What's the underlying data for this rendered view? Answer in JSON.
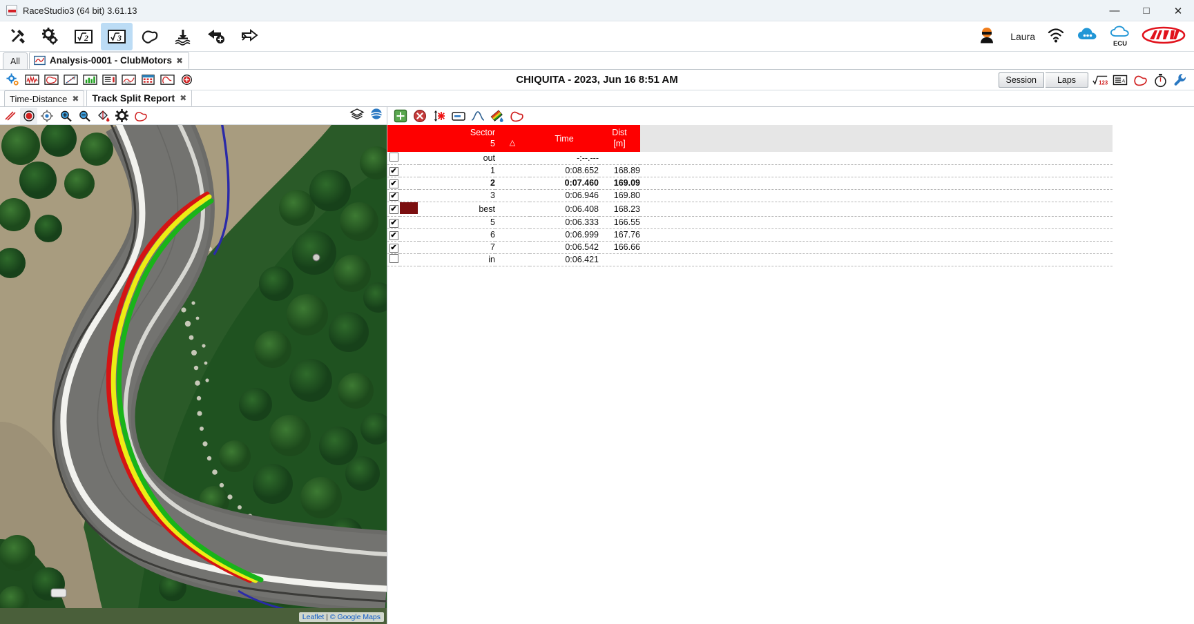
{
  "window": {
    "title": "RaceStudio3 (64 bit) 3.61.13",
    "minimize": "—",
    "maximize": "☐",
    "close": "✕"
  },
  "main_toolbar": {
    "icons": [
      {
        "name": "tools-icon",
        "label": "Tools",
        "active": false
      },
      {
        "name": "configuration-gear-icon",
        "label": "Configurations",
        "active": false
      },
      {
        "name": "rs2-analysis-icon",
        "label": "√2",
        "active": false
      },
      {
        "name": "rs3-analysis-icon",
        "label": "√3",
        "active": true
      },
      {
        "name": "tracks-icon",
        "label": "Tracks",
        "active": false
      },
      {
        "name": "device-download-icon",
        "label": "Download",
        "active": false
      },
      {
        "name": "import-arrow-icon",
        "label": "Import",
        "active": false
      },
      {
        "name": "export-arrow-icon",
        "label": "Export",
        "active": false
      }
    ],
    "user": "Laura",
    "right_icons": [
      {
        "name": "wifi-icon",
        "label": "WiFi"
      },
      {
        "name": "cloud-messages-icon",
        "label": "Messages"
      },
      {
        "name": "cloud-ecu-icon",
        "label": "ECU"
      },
      {
        "name": "aim-logo",
        "label": "AiM"
      }
    ]
  },
  "project_tabs": {
    "all_label": "All",
    "active_tab": "Analysis-0001 - ClubMotors",
    "close_glyph": "✖"
  },
  "session_toolbar": {
    "icons": [
      {
        "name": "settings-small-icon"
      },
      {
        "name": "time-distance-chart-icon"
      },
      {
        "name": "track-map-icon"
      },
      {
        "name": "xy-plot-icon"
      },
      {
        "name": "histogram-icon"
      },
      {
        "name": "report-icon"
      },
      {
        "name": "scatter-icon"
      },
      {
        "name": "calendar-icon"
      },
      {
        "name": "track-report-icon"
      },
      {
        "name": "add-red-icon"
      }
    ],
    "session_title": "CHIQUITA  - 2023, Jun 16 8:51 AM",
    "session_button": "Session",
    "laps_button": "Laps",
    "right_icons": [
      {
        "name": "math-channels-icon",
        "label": "√123"
      },
      {
        "name": "channels-list-icon"
      },
      {
        "name": "track-shape-icon"
      },
      {
        "name": "lap-timer-icon"
      },
      {
        "name": "wrench-settings-icon"
      }
    ]
  },
  "view_tabs": [
    {
      "label": "Time-Distance",
      "active": false,
      "close": "✖"
    },
    {
      "label": "Track Split Report",
      "active": true,
      "close": "✖"
    }
  ],
  "map_toolbar": {
    "left_icons": [
      {
        "name": "measure-lines-icon",
        "selected": false
      },
      {
        "name": "record-point-icon",
        "selected": true
      },
      {
        "name": "center-crosshair-icon",
        "selected": false
      },
      {
        "name": "zoom-in-icon",
        "selected": false
      },
      {
        "name": "zoom-out-icon",
        "selected": false
      },
      {
        "name": "paint-bucket-icon",
        "selected": false
      },
      {
        "name": "map-settings-gear-icon",
        "selected": false
      },
      {
        "name": "track-outline-icon",
        "selected": false
      }
    ],
    "right_icons": [
      {
        "name": "map-layers-icon"
      },
      {
        "name": "map-style-icon"
      }
    ]
  },
  "map": {
    "attribution_leaflet": "Leaflet",
    "attribution_separator": " | ",
    "attribution_provider": "© Google Maps",
    "racing_lines": [
      {
        "name": "lap-line-green",
        "color": "#19b419"
      },
      {
        "name": "lap-line-yellow",
        "color": "#eded14"
      },
      {
        "name": "lap-line-red",
        "color": "#d41414"
      },
      {
        "name": "lap-line-blue",
        "color": "#2222aa"
      }
    ]
  },
  "table_toolbar": {
    "icons": [
      {
        "name": "add-split-icon",
        "label": "+"
      },
      {
        "name": "remove-split-icon",
        "label": "✕"
      },
      {
        "name": "insert-split-icon"
      },
      {
        "name": "rename-split-icon"
      },
      {
        "name": "curve-view-icon"
      },
      {
        "name": "colors-icon"
      },
      {
        "name": "track-shape-icon"
      }
    ]
  },
  "split_table": {
    "headers": {
      "sector_top": "Sector",
      "sector_bottom": "5",
      "delta": "△",
      "time": "Time",
      "dist_top": "Dist",
      "dist_bottom": "[m]"
    },
    "rows": [
      {
        "checked": false,
        "swatch": null,
        "sector": "out",
        "time": "-:--.---",
        "dist": "",
        "sector_style": "grey",
        "time_style": "grey",
        "dist_style": "normal"
      },
      {
        "checked": true,
        "swatch": null,
        "sector": "1",
        "time": "0:08.652",
        "dist": "168.89",
        "sector_style": "normal",
        "time_style": "red",
        "dist_style": "normal"
      },
      {
        "checked": true,
        "swatch": null,
        "sector": "2",
        "time": "0:07.460",
        "dist": "169.09",
        "sector_style": "bold",
        "time_style": "bold",
        "dist_style": "bold"
      },
      {
        "checked": true,
        "swatch": null,
        "sector": "3",
        "time": "0:06.946",
        "dist": "169.80",
        "sector_style": "normal",
        "time_style": "normal",
        "dist_style": "red"
      },
      {
        "checked": true,
        "swatch": "#7b0f10",
        "sector": "best",
        "time": "0:06.408",
        "dist": "168.23",
        "sector_style": "normal",
        "time_style": "normal",
        "dist_style": "normal"
      },
      {
        "checked": true,
        "swatch": null,
        "sector": "5",
        "time": "0:06.333",
        "dist": "166.55",
        "sector_style": "normal",
        "time_style": "blue",
        "dist_style": "blue"
      },
      {
        "checked": true,
        "swatch": null,
        "sector": "6",
        "time": "0:06.999",
        "dist": "167.76",
        "sector_style": "normal",
        "time_style": "normal",
        "dist_style": "normal"
      },
      {
        "checked": true,
        "swatch": null,
        "sector": "7",
        "time": "0:06.542",
        "dist": "166.66",
        "sector_style": "normal",
        "time_style": "normal",
        "dist_style": "normal"
      },
      {
        "checked": false,
        "swatch": null,
        "sector": "in",
        "time": "0:06.421",
        "dist": "",
        "sector_style": "grey",
        "time_style": "grey",
        "dist_style": "normal"
      }
    ]
  },
  "colors": {
    "header_red": "#fe0000",
    "accent_orange": "#f07d1a",
    "tab_active_blue": "#bcdcf5",
    "best_swatch": "#7b0f10"
  }
}
